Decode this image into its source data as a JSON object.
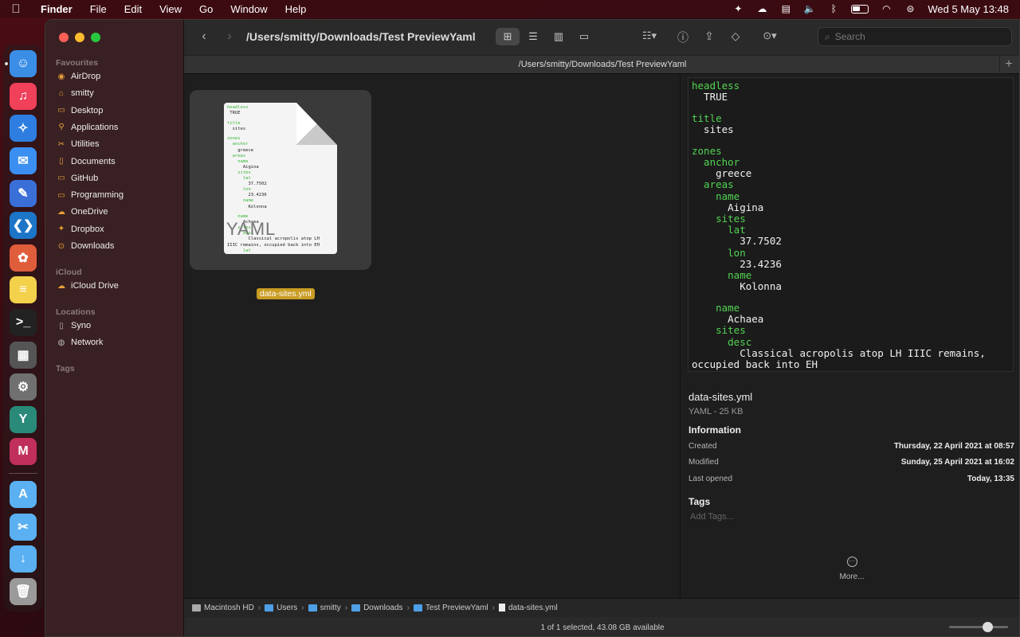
{
  "menubar": {
    "app_name": "Finder",
    "items": [
      "File",
      "Edit",
      "View",
      "Go",
      "Window",
      "Help"
    ],
    "clock": "Wed 5 May  13:48"
  },
  "sidebar": {
    "favourites_heading": "Favourites",
    "favourites": [
      {
        "label": "AirDrop",
        "icon": "airdrop-icon"
      },
      {
        "label": "smitty",
        "icon": "home-icon"
      },
      {
        "label": "Desktop",
        "icon": "desktop-icon"
      },
      {
        "label": "Applications",
        "icon": "applications-icon"
      },
      {
        "label": "Utilities",
        "icon": "utilities-icon"
      },
      {
        "label": "Documents",
        "icon": "document-icon"
      },
      {
        "label": "GitHub",
        "icon": "folder-icon"
      },
      {
        "label": "Programming",
        "icon": "folder-icon"
      },
      {
        "label": "OneDrive",
        "icon": "cloud-icon"
      },
      {
        "label": "Dropbox",
        "icon": "dropbox-icon"
      },
      {
        "label": "Downloads",
        "icon": "downloads-icon"
      }
    ],
    "icloud_heading": "iCloud",
    "icloud": [
      {
        "label": "iCloud Drive",
        "icon": "cloud-icon"
      }
    ],
    "locations_heading": "Locations",
    "locations": [
      {
        "label": "Syno",
        "icon": "document-icon"
      },
      {
        "label": "Network",
        "icon": "globe-icon"
      }
    ],
    "tags_heading": "Tags"
  },
  "toolbar": {
    "path_title": "/Users/smitty/Downloads/Test PreviewYaml",
    "search_placeholder": "Search"
  },
  "tab": {
    "title": "/Users/smitty/Downloads/Test PreviewYaml"
  },
  "file": {
    "name": "data-sites.yml",
    "thumbnail_label": "YAML",
    "thumbnail_lines": [
      [
        "k",
        "headless"
      ],
      [
        "v",
        " TRUE"
      ],
      [
        "v",
        ""
      ],
      [
        "k",
        "title"
      ],
      [
        "v",
        "  sites"
      ],
      [
        "v",
        ""
      ],
      [
        "k",
        "zones"
      ],
      [
        "k",
        "  anchor"
      ],
      [
        "v",
        "    greece"
      ],
      [
        "k",
        "  areas"
      ],
      [
        "k",
        "    name"
      ],
      [
        "v",
        "      Aigina"
      ],
      [
        "k",
        "    sites"
      ],
      [
        "k",
        "      lat"
      ],
      [
        "v",
        "        37.7502"
      ],
      [
        "k",
        "      lon"
      ],
      [
        "v",
        "        23.4236"
      ],
      [
        "k",
        "      name"
      ],
      [
        "v",
        "        Kolonna"
      ],
      [
        "v",
        ""
      ],
      [
        "k",
        "    name"
      ],
      [
        "v",
        "      Achaea"
      ],
      [
        "k",
        "    sites"
      ],
      [
        "k",
        "      desc"
      ],
      [
        "v",
        "        Classical acropolis atop LH"
      ],
      [
        "v",
        "IIIC remains, occupied back into EH"
      ],
      [
        "k",
        "      lat"
      ]
    ]
  },
  "preview": {
    "yaml_lines": [
      [
        "k",
        "headless"
      ],
      [
        "v",
        "  TRUE"
      ],
      [
        "v",
        ""
      ],
      [
        "k",
        "title"
      ],
      [
        "v",
        "  sites"
      ],
      [
        "v",
        ""
      ],
      [
        "k",
        "zones"
      ],
      [
        "k",
        "  anchor"
      ],
      [
        "v",
        "    greece"
      ],
      [
        "k",
        "  areas"
      ],
      [
        "k",
        "    name"
      ],
      [
        "v",
        "      Aigina"
      ],
      [
        "k",
        "    sites"
      ],
      [
        "k",
        "      lat"
      ],
      [
        "v",
        "        37.7502"
      ],
      [
        "k",
        "      lon"
      ],
      [
        "v",
        "        23.4236"
      ],
      [
        "k",
        "      name"
      ],
      [
        "v",
        "        Kolonna"
      ],
      [
        "v",
        ""
      ],
      [
        "k",
        "    name"
      ],
      [
        "v",
        "      Achaea"
      ],
      [
        "k",
        "    sites"
      ],
      [
        "k",
        "      desc"
      ],
      [
        "v",
        "        Classical acropolis atop LH IIIC remains,"
      ],
      [
        "v",
        "occupied back into EH"
      ]
    ],
    "file_name": "data-sites.yml",
    "file_kind": "YAML - 25 KB",
    "information_heading": "Information",
    "info": [
      {
        "label": "Created",
        "value": "Thursday, 22 April 2021 at 08:57"
      },
      {
        "label": "Modified",
        "value": "Sunday, 25 April 2021 at 16:02"
      },
      {
        "label": "Last opened",
        "value": "Today, 13:35"
      }
    ],
    "tags_heading": "Tags",
    "add_tags_placeholder": "Add Tags...",
    "more_label": "More..."
  },
  "pathbar": [
    {
      "label": "Macintosh HD",
      "kind": "disk"
    },
    {
      "label": "Users",
      "kind": "folder"
    },
    {
      "label": "smitty",
      "kind": "folder"
    },
    {
      "label": "Downloads",
      "kind": "folder"
    },
    {
      "label": "Test PreviewYaml",
      "kind": "folder"
    },
    {
      "label": "data-sites.yml",
      "kind": "file"
    }
  ],
  "statusbar": {
    "text": "1 of 1 selected, 43.08 GB available",
    "zoom": 0.65
  },
  "dock": [
    {
      "name": "finder",
      "color": "#3a8ee6",
      "glyph": "☺",
      "running": true
    },
    {
      "name": "music",
      "color": "#f0405a",
      "glyph": "♫"
    },
    {
      "name": "safari",
      "color": "#2d7ee0",
      "glyph": "✧"
    },
    {
      "name": "mail",
      "color": "#3b8ff0",
      "glyph": "✉"
    },
    {
      "name": "xcode-instruments",
      "color": "#3a6fd8",
      "glyph": "✎"
    },
    {
      "name": "vscode",
      "color": "#1d75c8",
      "glyph": "❮❯"
    },
    {
      "name": "pixelmator",
      "color": "#e05d3c",
      "glyph": "✿"
    },
    {
      "name": "notes",
      "color": "#f3d14b",
      "glyph": "≡"
    },
    {
      "name": "terminal",
      "color": "#222222",
      "glyph": ">_"
    },
    {
      "name": "calculator",
      "color": "#555555",
      "glyph": "▦"
    },
    {
      "name": "system-preferences",
      "color": "#707070",
      "glyph": "⚙"
    },
    {
      "name": "preview-yaml",
      "color": "#2a8a7a",
      "glyph": "Y"
    },
    {
      "name": "preview-markdown",
      "color": "#c0305a",
      "glyph": "M"
    },
    {
      "name": "sep"
    },
    {
      "name": "applications-folder",
      "color": "#5ab0f0",
      "glyph": "A"
    },
    {
      "name": "utilities-folder",
      "color": "#5ab0f0",
      "glyph": "✂"
    },
    {
      "name": "downloads-folder",
      "color": "#5ab0f0",
      "glyph": "↓"
    },
    {
      "name": "trash",
      "color": "#9a9a9a",
      "glyph": "🗑"
    }
  ]
}
